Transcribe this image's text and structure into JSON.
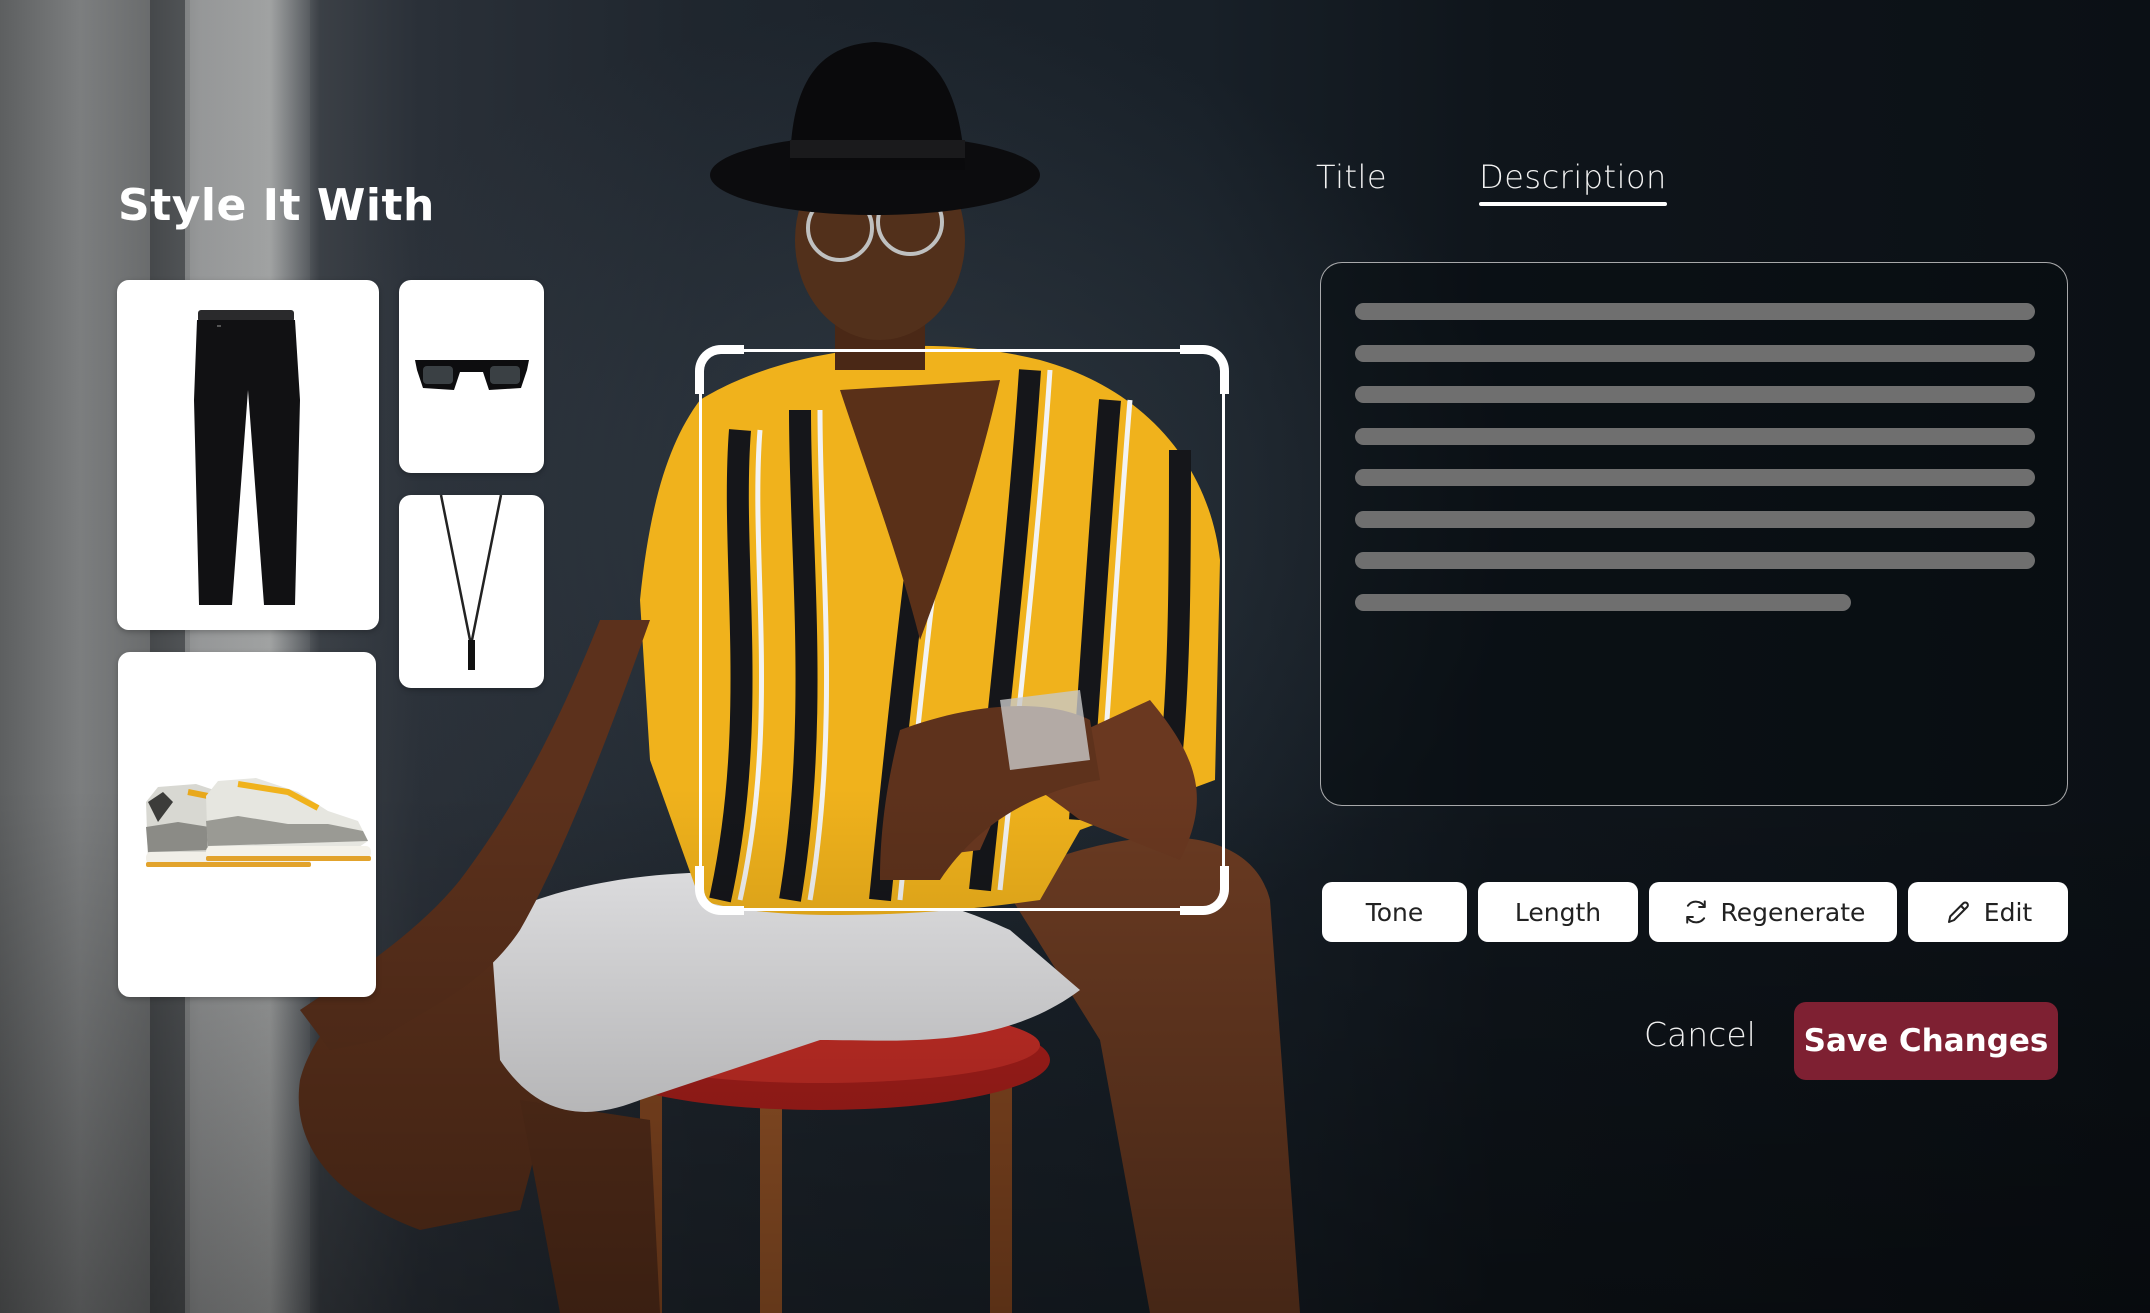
{
  "style_panel": {
    "title": "Style It With",
    "items": [
      {
        "name": "Black trousers",
        "icon": "pants-icon"
      },
      {
        "name": "Black rectangular sunglasses",
        "icon": "sunglasses-icon"
      },
      {
        "name": "Black pendant necklace",
        "icon": "necklace-icon"
      },
      {
        "name": "Grey and white sneakers with yellow laces",
        "icon": "sneakers-icon"
      }
    ]
  },
  "tabs": [
    {
      "label": "Title",
      "active": false
    },
    {
      "label": "Description",
      "active": true
    }
  ],
  "description": {
    "placeholder_lines": [
      1.0,
      1.0,
      1.0,
      1.0,
      1.0,
      1.0,
      1.0,
      0.73
    ]
  },
  "toolbar": {
    "tone_label": "Tone",
    "length_label": "Length",
    "regenerate_label": "Regenerate",
    "regenerate_icon": "refresh-icon",
    "edit_label": "Edit",
    "edit_icon": "pencil-icon"
  },
  "footer": {
    "cancel_label": "Cancel",
    "save_label": "Save Changes"
  },
  "colors": {
    "accent": "#7e2032",
    "placeholder_line": "#6f6f6f",
    "shirt_yellow": "#f0b21c"
  }
}
